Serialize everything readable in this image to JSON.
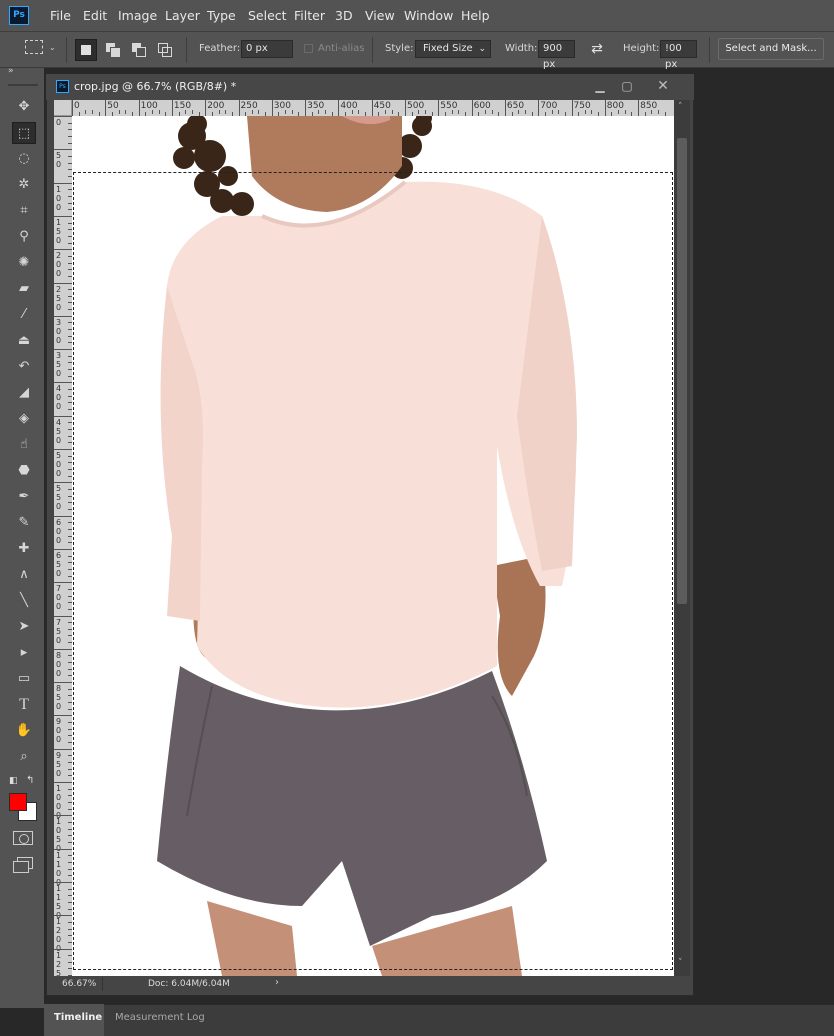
{
  "app": {
    "logo": "Ps"
  },
  "menu": [
    "File",
    "Edit",
    "Image",
    "Layer",
    "Type",
    "Select",
    "Filter",
    "3D",
    "View",
    "Window",
    "Help"
  ],
  "options": {
    "feather_label": "Feather:",
    "feather_value": "0 px",
    "antialias_label": "Anti-alias",
    "style_label": "Style:",
    "style_value": "Fixed Size",
    "width_label": "Width:",
    "width_value": "900 px",
    "height_label": "Height:",
    "height_value": "!00 px",
    "select_mask": "Select and Mask..."
  },
  "document": {
    "title": "crop.jpg @ 66.7% (RGB/8#) *",
    "zoom": "66.67%",
    "doc_size": "Doc: 6.04M/6.04M",
    "ruler_h": [
      "0",
      "50",
      "100",
      "150",
      "200",
      "250",
      "300",
      "350",
      "400",
      "450",
      "500",
      "550",
      "600",
      "650",
      "700",
      "750",
      "800",
      "850"
    ],
    "ruler_v": [
      "0",
      "50",
      "100",
      "150",
      "200",
      "250",
      "300",
      "350",
      "400",
      "450",
      "500",
      "550",
      "600",
      "650",
      "700",
      "750",
      "800",
      "850",
      "900",
      "950",
      "1000",
      "1050",
      "1100",
      "1150",
      "1200",
      "1250"
    ]
  },
  "colors": {
    "foreground": "#ff0000",
    "background": "#ffffff",
    "accent": "#31a8ff"
  },
  "panels": [
    "Timeline",
    "Measurement Log"
  ],
  "tools": [
    "move-icon",
    "rect-marquee-icon",
    "lasso-icon",
    "magic-wand-icon",
    "crop-icon",
    "eyedropper-icon",
    "spot-heal-icon",
    "band-aid-icon",
    "brush-icon",
    "stamp-icon",
    "history-brush-icon",
    "eraser-icon",
    "paint-bucket-icon",
    "smudge-icon",
    "sponge-icon",
    "pen-icon",
    "freeform-pen-icon",
    "add-anchor-icon",
    "convert-point-icon",
    "line-icon",
    "path-select-icon",
    "direct-select-icon",
    "rectangle-icon",
    "type-icon",
    "hand-icon",
    "zoom-icon"
  ]
}
